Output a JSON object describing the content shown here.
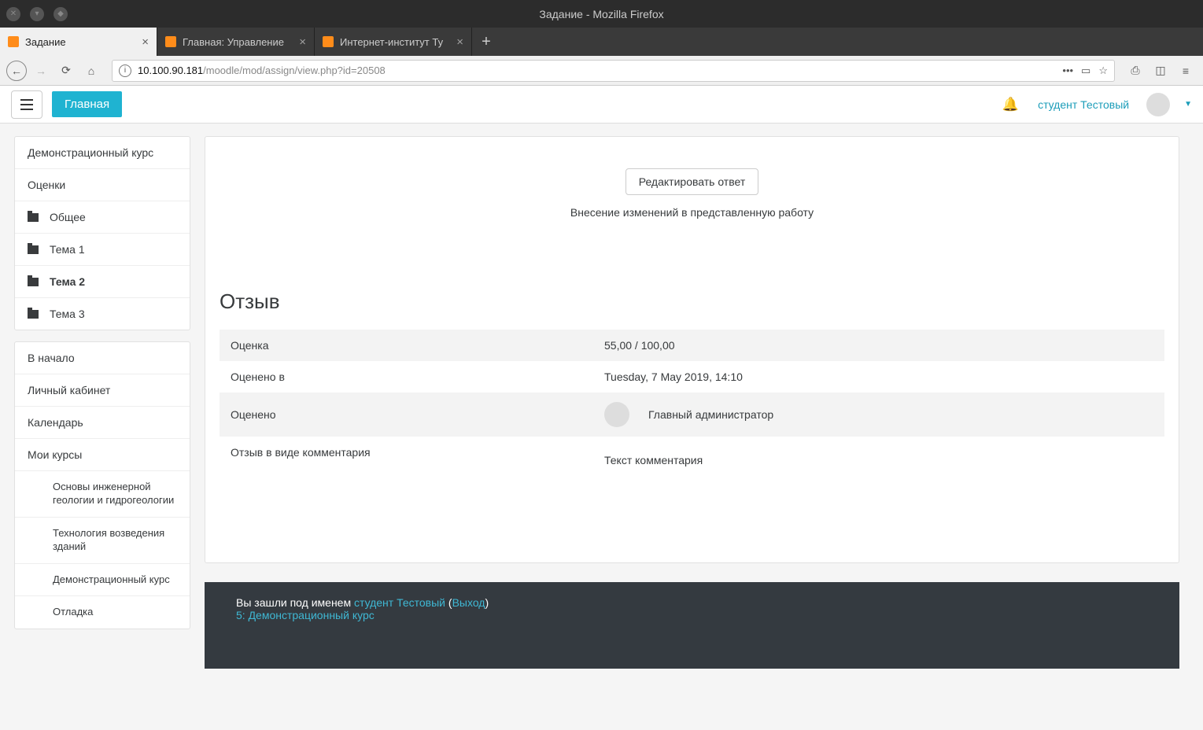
{
  "os": {
    "title": "Задание - Mozilla Firefox"
  },
  "tabs": [
    {
      "label": "Задание"
    },
    {
      "label": "Главная: Управление"
    },
    {
      "label": "Интернет-институт Ту"
    }
  ],
  "newtab": "+",
  "url": {
    "host": "10.100.90.181",
    "path": "/moodle/mod/assign/view.php?id=20508",
    "dots": "•••"
  },
  "header": {
    "home": "Главная",
    "user": "студент Тестовый"
  },
  "sidebar": {
    "course": [
      {
        "label": "Демонстрационный курс"
      },
      {
        "label": "Оценки"
      }
    ],
    "topics": [
      {
        "label": "Общее"
      },
      {
        "label": "Тема 1"
      },
      {
        "label": "Тема 2",
        "active": true
      },
      {
        "label": "Тема 3"
      }
    ],
    "nav": [
      {
        "label": "В начало"
      },
      {
        "label": "Личный кабинет"
      },
      {
        "label": "Календарь"
      },
      {
        "label": "Мои курсы"
      }
    ],
    "courses": [
      {
        "label": "Основы инженерной геологии и гидрогеологии"
      },
      {
        "label": "Технология возведения зданий"
      },
      {
        "label": "Демонстрационный курс"
      },
      {
        "label": "Отладка"
      }
    ]
  },
  "main": {
    "edit_button": "Редактировать ответ",
    "edit_help": "Внесение изменений в представленную работу",
    "feedback_heading": "Отзыв",
    "rows": {
      "grade_label": "Оценка",
      "grade_value": "55,00 / 100,00",
      "graded_at_label": "Оценено в",
      "graded_at_value": "Tuesday, 7 May 2019, 14:10",
      "graded_by_label": "Оценено",
      "graded_by_value": "Главный администратор",
      "comment_label": "Отзыв в виде комментария",
      "comment_value": "Текст комментария"
    }
  },
  "footer": {
    "prefix": "Вы зашли под именем ",
    "user": "студент Тестовый",
    "open_paren": " (",
    "logout": "Выход",
    "close_paren": ")",
    "course_link": "5: Демонстрационный курс"
  }
}
